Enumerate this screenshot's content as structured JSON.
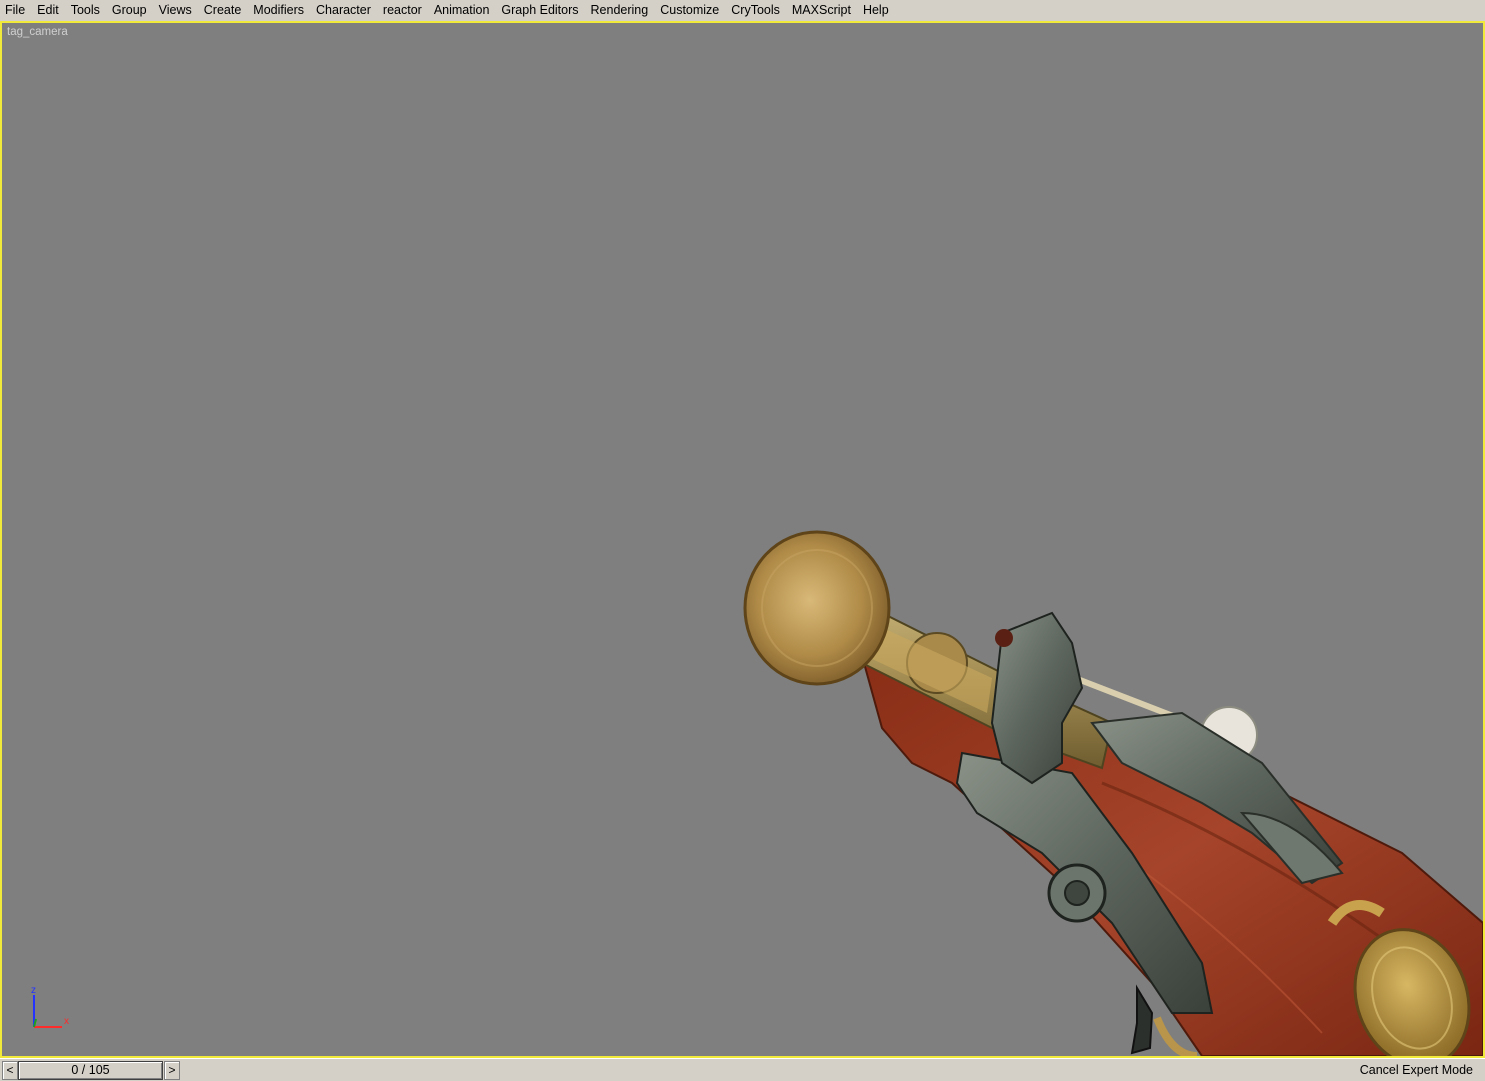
{
  "menubar": {
    "items": [
      "File",
      "Edit",
      "Tools",
      "Group",
      "Views",
      "Create",
      "Modifiers",
      "Character",
      "reactor",
      "Animation",
      "Graph Editors",
      "Rendering",
      "Customize",
      "CryTools",
      "MAXScript",
      "Help"
    ]
  },
  "viewport": {
    "label": "tag_camera",
    "border_color": "#f2ea3a",
    "background": "#7f7f7f",
    "axis": {
      "z": "z",
      "x": "x"
    }
  },
  "timeline": {
    "prev": "<",
    "next": ">",
    "frame_display": "0 / 105"
  },
  "status": {
    "expert_mode": "Cancel Expert Mode"
  }
}
